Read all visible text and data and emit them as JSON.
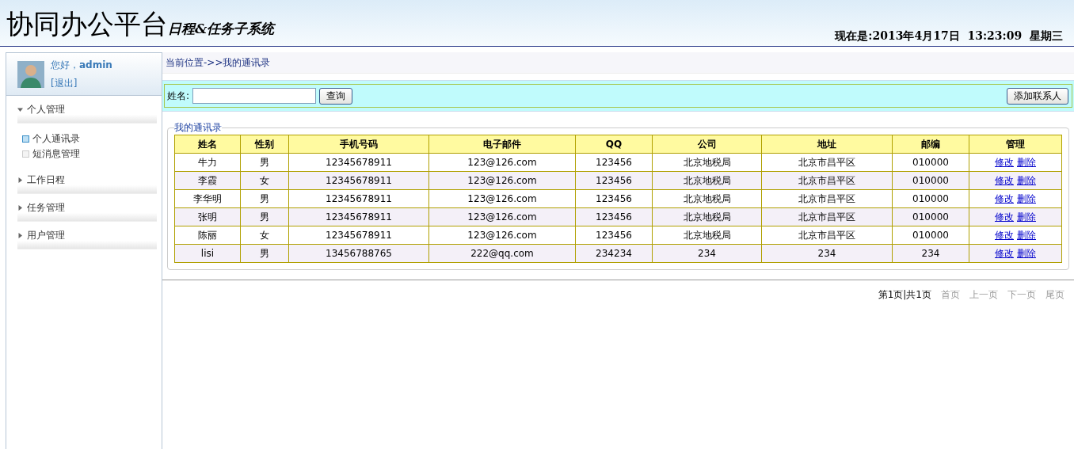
{
  "header": {
    "title": "协同办公平台",
    "subtitle": "日程&任务子系统",
    "datetime": "现在是:2013年4月17日  13:23:09  星期三"
  },
  "user": {
    "greeting": "您好，",
    "name": "admin",
    "logout": "[退出]"
  },
  "sidebar": {
    "sections": [
      {
        "label": "个人管理",
        "expanded": true,
        "items": [
          {
            "label": "个人通讯录",
            "selected": true
          },
          {
            "label": "短消息管理",
            "selected": false
          }
        ]
      },
      {
        "label": "工作日程",
        "expanded": false
      },
      {
        "label": "任务管理",
        "expanded": false
      },
      {
        "label": "用户管理",
        "expanded": false
      }
    ]
  },
  "breadcrumb": "当前位置->>我的通讯录",
  "search": {
    "label": "姓名:",
    "button": "查询",
    "add_button": "添加联系人"
  },
  "contacts": {
    "legend": "我的通讯录",
    "columns": [
      "姓名",
      "性别",
      "手机号码",
      "电子邮件",
      "QQ",
      "公司",
      "地址",
      "邮编",
      "管理"
    ],
    "rows": [
      {
        "cells": [
          "牛力",
          "男",
          "12345678911",
          "123@126.com",
          "123456",
          "北京地税局",
          "北京市昌平区",
          "010000"
        ],
        "actions": [
          "修改",
          "删除"
        ]
      },
      {
        "cells": [
          "李霞",
          "女",
          "12345678911",
          "123@126.com",
          "123456",
          "北京地税局",
          "北京市昌平区",
          "010000"
        ],
        "actions": [
          "修改",
          "删除"
        ]
      },
      {
        "cells": [
          "李华明",
          "男",
          "12345678911",
          "123@126.com",
          "123456",
          "北京地税局",
          "北京市昌平区",
          "010000"
        ],
        "actions": [
          "修改",
          "删除"
        ]
      },
      {
        "cells": [
          "张明",
          "男",
          "12345678911",
          "123@126.com",
          "123456",
          "北京地税局",
          "北京市昌平区",
          "010000"
        ],
        "actions": [
          "修改",
          "删除"
        ]
      },
      {
        "cells": [
          "陈丽",
          "女",
          "12345678911",
          "123@126.com",
          "123456",
          "北京地税局",
          "北京市昌平区",
          "010000"
        ],
        "actions": [
          "修改",
          "删除"
        ]
      },
      {
        "cells": [
          "lisi",
          "男",
          "13456788765",
          "222@qq.com",
          "234234",
          "234",
          "234",
          "234"
        ],
        "actions": [
          "修改",
          "删除"
        ]
      }
    ]
  },
  "pagination": {
    "status": "第1页|共1页",
    "links": [
      "首页",
      "上一页",
      "下一页",
      "尾页"
    ]
  }
}
